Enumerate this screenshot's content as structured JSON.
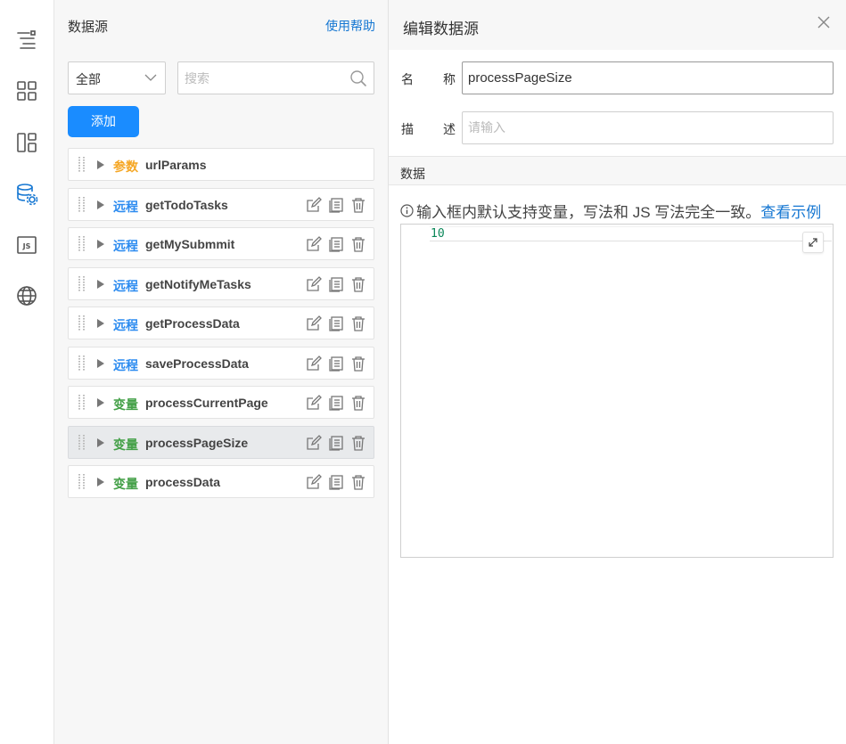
{
  "list_panel": {
    "title": "数据源",
    "help_link": "使用帮助",
    "filter_value": "全部",
    "search_placeholder": "搜索",
    "add_label": "添加",
    "items": [
      {
        "type": "参数",
        "kind": "param",
        "name": "urlParams",
        "actions": false,
        "selected": false
      },
      {
        "type": "远程",
        "kind": "remote",
        "name": "getTodoTasks",
        "actions": true,
        "selected": false
      },
      {
        "type": "远程",
        "kind": "remote",
        "name": "getMySubmmit",
        "actions": true,
        "selected": false
      },
      {
        "type": "远程",
        "kind": "remote",
        "name": "getNotifyMeTasks",
        "actions": true,
        "selected": false
      },
      {
        "type": "远程",
        "kind": "remote",
        "name": "getProcessData",
        "actions": true,
        "selected": false
      },
      {
        "type": "远程",
        "kind": "remote",
        "name": "saveProcessData",
        "actions": true,
        "selected": false
      },
      {
        "type": "变量",
        "kind": "var",
        "name": "processCurrentPage",
        "actions": true,
        "selected": false
      },
      {
        "type": "变量",
        "kind": "var",
        "name": "processPageSize",
        "actions": true,
        "selected": true
      },
      {
        "type": "变量",
        "kind": "var",
        "name": "processData",
        "actions": true,
        "selected": false
      }
    ]
  },
  "editor": {
    "title": "编辑数据源",
    "name_label_1": "名",
    "name_label_2": "称",
    "name_value": "processPageSize",
    "desc_label_1": "描",
    "desc_label_2": "述",
    "desc_placeholder": "请输入",
    "section_title": "数据",
    "hint_text": "输入框内默认支持变量，写法和 JS 写法完全一致。",
    "hint_link": "查看示例",
    "code_value": "10"
  },
  "colors": {
    "primary": "#1a8cff",
    "link": "#1677d2",
    "param": "#f5a623",
    "remote": "#2d8cf0",
    "var": "#43a047"
  }
}
